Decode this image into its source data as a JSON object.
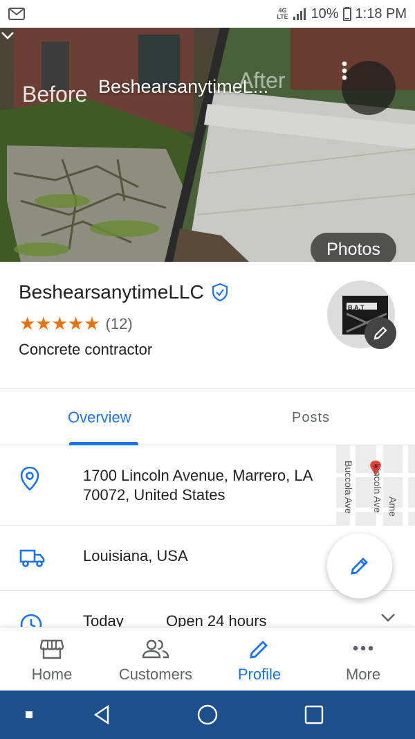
{
  "status_bar": {
    "network": "4G LTE",
    "battery": "10%",
    "time": "1:18 PM"
  },
  "hero": {
    "before_label": "Before",
    "after_label": "After",
    "title": "BeshearsanytimeL...",
    "photos_button": "Photos"
  },
  "business": {
    "name": "BeshearsanytimeLLC",
    "rating_count": "(12)",
    "stars": 5,
    "category": "Concrete contractor",
    "logo_text": "B.A.T"
  },
  "tabs": {
    "overview": "Overview",
    "posts": "Posts"
  },
  "details": {
    "address_line1": "1700 Lincoln Avenue, Marrero, LA",
    "address_line2": "70072, United States",
    "service_area": "Louisiana, USA",
    "hours_day": "Today",
    "hours_value": "Open 24 hours",
    "map_street_1": "Buccola Ave",
    "map_street_2": "Lincoln Ave",
    "map_street_3": "Ame"
  },
  "bottom_nav": {
    "home": "Home",
    "customers": "Customers",
    "profile": "Profile",
    "more": "More"
  },
  "colors": {
    "accent": "#1a73e8",
    "star": "#e8710a",
    "system_nav": "#1c4f8c"
  }
}
